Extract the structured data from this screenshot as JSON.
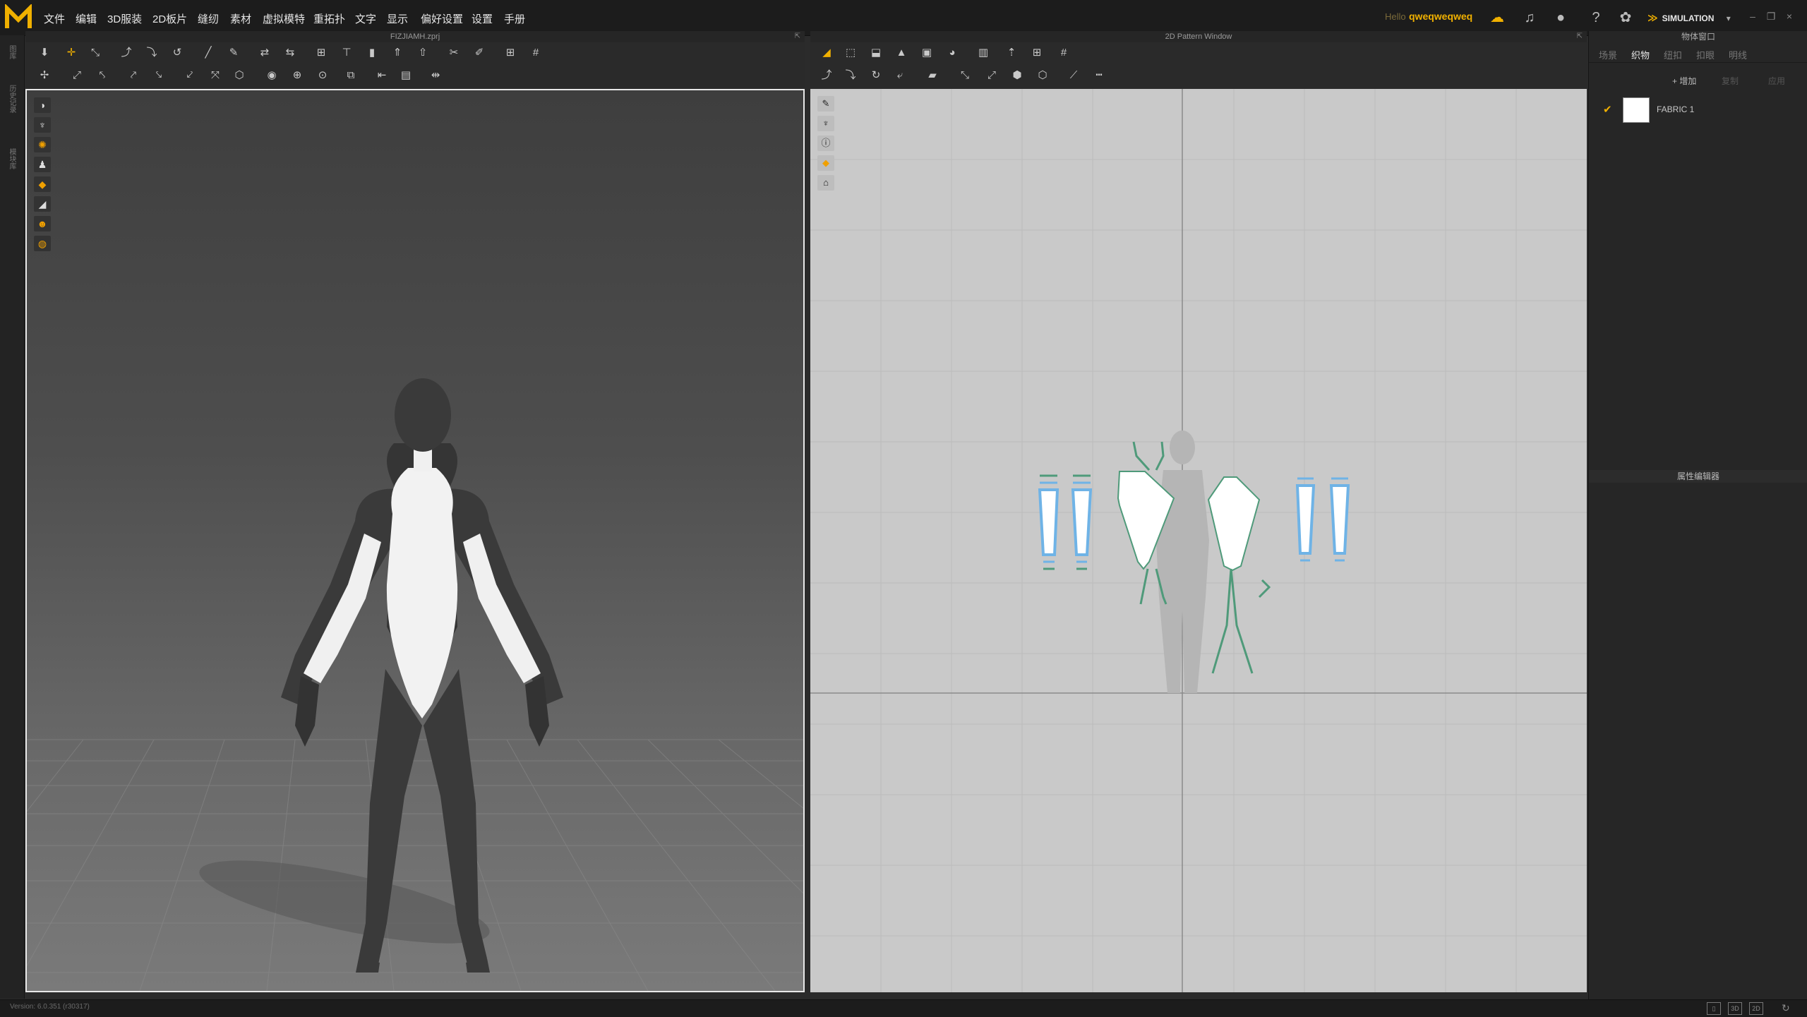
{
  "menubar": {
    "items": [
      "文件",
      "编辑",
      "3D服装",
      "2D板片",
      "缝纫",
      "素材",
      "虚拟模特",
      "重拓扑",
      "文字",
      "显示",
      "偏好设置",
      "设置",
      "手册"
    ],
    "hello_label": "Hello",
    "username": "qweqweqweq",
    "mode_label": "SIMULATION"
  },
  "panels": {
    "viewport3d_title": "FIZJIAMH.zprj",
    "pattern_title": "2D Pattern Window",
    "object_browser_title": "物体窗口",
    "property_editor_title": "属性编辑器"
  },
  "object_browser": {
    "tabs": [
      "场景",
      "织物",
      "纽扣",
      "扣眼",
      "明线"
    ],
    "active_tab": "织物",
    "buttons": {
      "add": "+ 增加",
      "copy": "复制",
      "apply": "应用"
    },
    "fabrics": [
      {
        "name": "FABRIC 1",
        "color": "#ffffff",
        "checked": true
      }
    ]
  },
  "left_strip": {
    "tabs": [
      "图库",
      "历史记录",
      "模块库"
    ]
  },
  "status": {
    "version": "Version: 6.0.351 (r30317)"
  },
  "colors": {
    "accent": "#f0b000",
    "pattern_outline": "#6fb3e6",
    "seam_line": "#4f9a7a"
  }
}
